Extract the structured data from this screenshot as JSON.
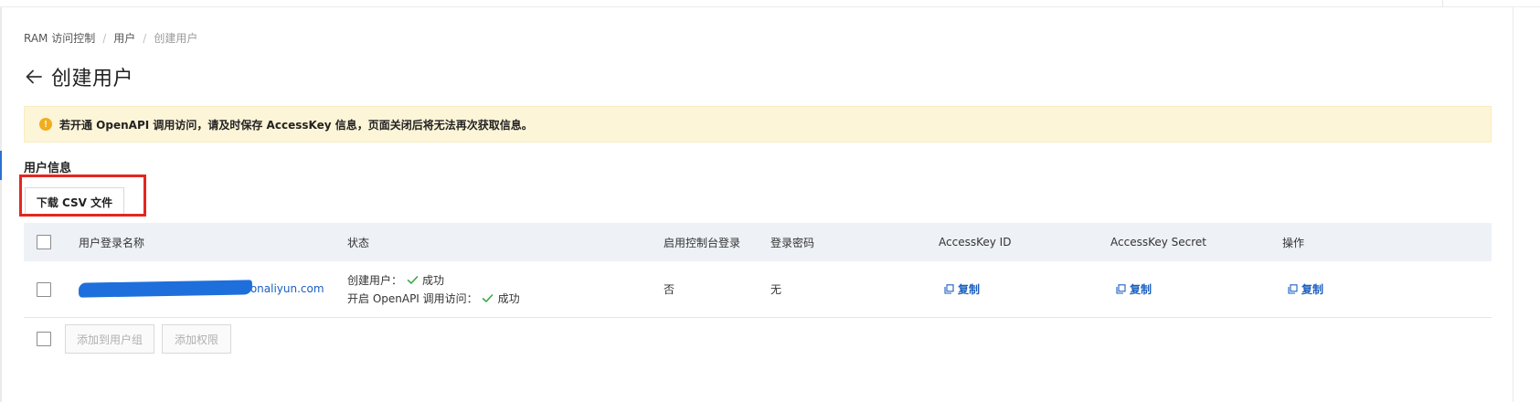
{
  "breadcrumb": {
    "items": [
      "RAM 访问控制",
      "用户"
    ],
    "separator": "/",
    "current": "创建用户"
  },
  "title": "创建用户",
  "banner": {
    "icon": "warning-circle-icon",
    "text": "若开通 OpenAPI 调用访问，请及时保存 AccessKey 信息，页面关闭后将无法再次获取信息。"
  },
  "section_title": "用户信息",
  "download_csv_label": "下载 CSV 文件",
  "table": {
    "headers": [
      "用户登录名称",
      "状态",
      "启用控制台登录",
      "登录密码",
      "AccessKey ID",
      "AccessKey Secret",
      "操作"
    ],
    "rows": [
      {
        "username_suffix": ".onaliyun.com",
        "status": [
          {
            "label": "创建用户：",
            "result": "成功"
          },
          {
            "label": "开启 OpenAPI 调用访问：",
            "result": "成功"
          }
        ],
        "console_login": "否",
        "password": "无",
        "access_key_id_action": "复制",
        "access_key_secret_action": "复制",
        "operation_action": "复制"
      }
    ]
  },
  "footer": {
    "add_to_group_label": "添加到用户组",
    "add_permission_label": "添加权限"
  },
  "colors": {
    "accent": "#1b5fbf",
    "warning_bg": "#fdf5d8",
    "warning_icon": "#f1ad1c",
    "success": "#3aa845",
    "highlight": "#e3261f",
    "header_bg": "#eef1f5"
  }
}
